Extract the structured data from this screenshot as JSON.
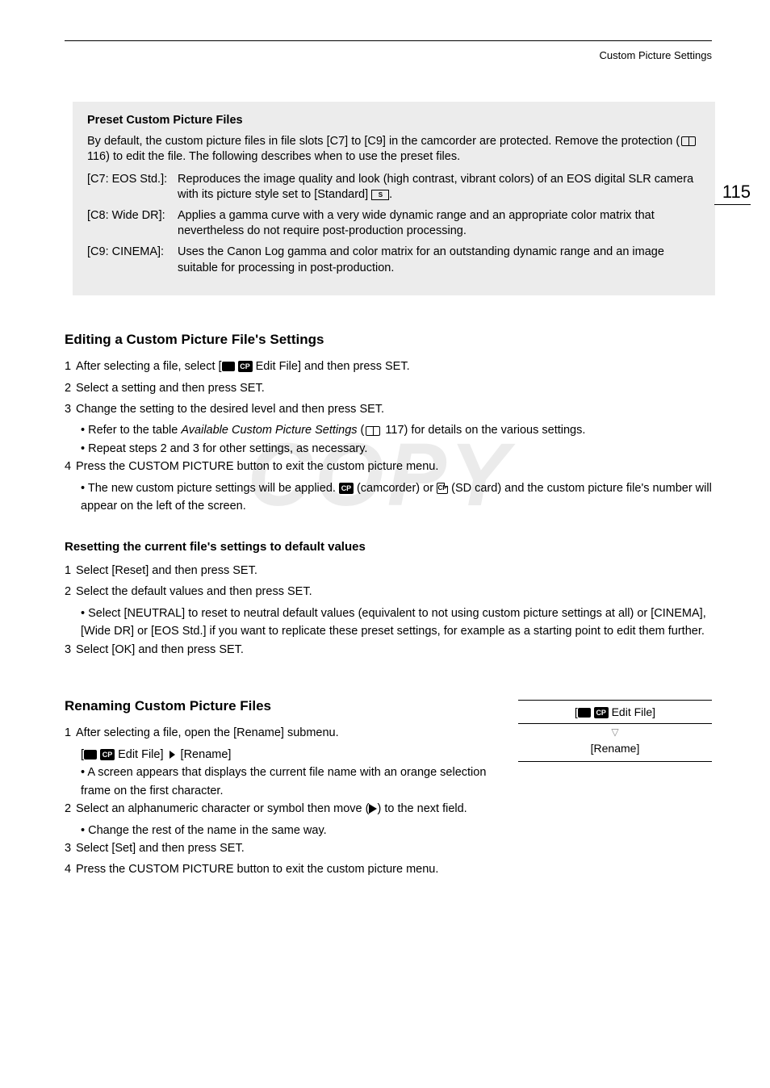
{
  "header": {
    "running": "Custom Picture Settings",
    "page": "115"
  },
  "watermark": "COPY",
  "presetBox": {
    "title": "Preset Custom Picture Files",
    "intro1": "By default, the custom picture files in file slots [C7] to [C9] in the camcorder are protected. Remove the protection (",
    "introRef": " 116) to edit the file. The following describes when to use the preset files.",
    "rows": [
      {
        "label": "[C7: EOS Std.]:",
        "desc1": "Reproduces the image quality and look (high contrast, vibrant colors) of an EOS digital SLR camera with its picture style set to [Standard] ",
        "desc2": "."
      },
      {
        "label": "[C8: Wide DR]:",
        "desc1": "Applies a gamma curve with a very wide dynamic range and an appropriate color matrix that nevertheless do not require post-production processing.",
        "desc2": ""
      },
      {
        "label": "[C9: CINEMA]:",
        "desc1": "Uses the Canon Log gamma and color matrix for an outstanding dynamic range and an image suitable for processing in post-production.",
        "desc2": ""
      }
    ]
  },
  "editing": {
    "title": "Editing a Custom Picture File's Settings",
    "s1a": "After selecting a file, select [",
    "s1b": " Edit File] and then press SET.",
    "s2": "Select a setting and then press SET.",
    "s3": "Change the setting to the desired level and then press SET.",
    "s3b1a": "Refer to the table ",
    "s3b1i": "Available Custom Picture Settings",
    "s3b1b": " (",
    "s3b1c": " 117) for details on the various settings.",
    "s3b2": "Repeat steps 2 and 3 for other settings, as necessary.",
    "s4": "Press the CUSTOM PICTURE button to exit the custom picture menu.",
    "s4b1a": "The new custom picture settings will be applied. ",
    "s4b1b": " (camcorder) or ",
    "s4b1c": " (SD card) and the custom picture file's number will appear on the left of the screen."
  },
  "resetting": {
    "title": "Resetting the current file's settings to default values",
    "s1": "Select [Reset] and then press SET.",
    "s2": "Select the default values and then press SET.",
    "s2b1": "Select [NEUTRAL] to reset to neutral default values (equivalent to not using custom picture settings at all) or [CINEMA], [Wide DR] or [EOS Std.] if you want to replicate these preset settings, for example as a starting point to edit them further.",
    "s3": "Select [OK] and then press SET."
  },
  "renaming": {
    "title": "Renaming Custom Picture Files",
    "s1": "After selecting a file, open the [Rename] submenu.",
    "s1patha": "[",
    "s1pathb": " Edit File] ",
    "s1pathc": " [Rename]",
    "s1b1": "A screen appears that displays the current file name with an orange selection frame on the first character.",
    "s2a": "Select an alphanumeric character or symbol then move (",
    "s2b": ") to the next field.",
    "s2b1": "Change the rest of the name in the same way.",
    "s3": "Select [Set] and then press SET.",
    "s4": "Press the CUSTOM PICTURE button to exit the custom picture menu.",
    "menuTopA": "[",
    "menuTopB": " Edit File]",
    "menuBottom": "[Rename]"
  }
}
